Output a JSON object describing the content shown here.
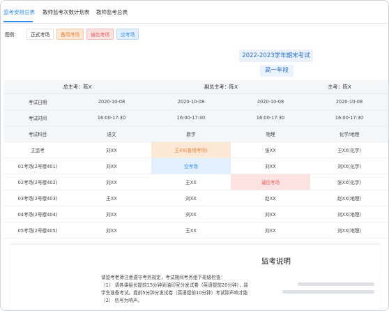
{
  "tabs": [
    {
      "label": "监考安排总表",
      "active": true
    },
    {
      "label": "教师监考次数计划表",
      "active": false
    },
    {
      "label": "教师监考总表",
      "active": false
    }
  ],
  "legend": {
    "label": "图例:",
    "items": [
      {
        "label": "正式考场",
        "kind": "formal"
      },
      {
        "label": "备用考场",
        "kind": "backup"
      },
      {
        "label": "诚信考场",
        "kind": "integrity"
      },
      {
        "label": "空考场",
        "kind": "empty"
      }
    ]
  },
  "colors": {
    "accent": "#2d8cf0",
    "backup": "#fde7d5",
    "integrity": "#fde2e2",
    "empty": "#e1efff"
  },
  "banner": {
    "title": "2022-2023学年期末考试",
    "subtitle": "高一年段"
  },
  "table": {
    "chiefs": {
      "chief": "总主考：陈X",
      "deputy": "副总主考：陈X",
      "main": "主考：陈X"
    },
    "date_row": {
      "label": "考试日期",
      "values": [
        "2020-10-08",
        "2020-10-08",
        "2020-10-08",
        "2020-10-08"
      ]
    },
    "time_row": {
      "label": "考试时间",
      "values": [
        "16:00-17:30",
        "16:00-17:30",
        "16:00-17:30",
        "16:00-17:30"
      ]
    },
    "subject_row": {
      "label": "考试科目",
      "values": [
        "语文",
        "数学",
        "物理",
        "化学/地理"
      ]
    },
    "rooms": [
      {
        "name": "主监考",
        "cells": [
          "刘XX",
          "王XX(备用考场)",
          "张XX",
          "王XX(化学)"
        ]
      },
      {
        "name": "01考场(2号楼401)",
        "cells": [
          "刘XX",
          "空考场",
          "刘XX",
          "刘XX(化学)"
        ]
      },
      {
        "name": "02考场(2号楼402)",
        "cells": [
          "刘XX",
          "王XX",
          "诚信考场",
          "张XX(化学)"
        ]
      },
      {
        "name": "03考场(2号楼403)",
        "cells": [
          "王XX",
          "刘XX",
          "赵XX",
          "赵XX(地理)"
        ]
      },
      {
        "name": "04考场(2号楼404)",
        "cells": [
          "刘XX",
          "刘XX",
          "刘XX",
          "刘XX(地理)"
        ]
      },
      {
        "name": "05考场(2号楼405)",
        "cells": [
          "刘XX",
          "王XX",
          "刘XX",
          "刘XX(地理)"
        ]
      }
    ]
  },
  "notes": {
    "title": "监考说明",
    "lines": [
      "请监考老师注意遵守考务规定，考试期间考务组下班级检查：",
      "（1） 请各课组长提前15分钟到油印室分发试卷（英语提前20分钟），监",
      "学生准备考试。提前5分钟分发试卷（英语提前10分钟）考试钟声响才能",
      "（2） 信号为响声。"
    ]
  }
}
